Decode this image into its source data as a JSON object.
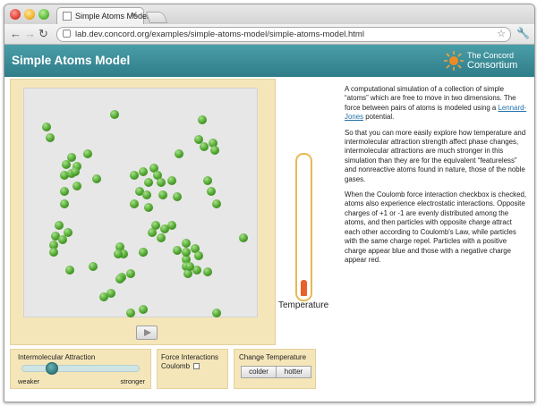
{
  "browser": {
    "tab_title": "Simple Atoms Model",
    "url": "lab.dev.concord.org/examples/simple-atoms-model/simple-atoms-model.html"
  },
  "header": {
    "title": "Simple Atoms Model",
    "logo_line1": "The Concord",
    "logo_line2": "Consortium"
  },
  "sim": {
    "atom_count": 74,
    "temperature_label": "Temperature",
    "temperature_fraction": 0.12,
    "play_icon": "play-icon"
  },
  "description": {
    "p1_before": "A computational simulation of a collection of simple “atoms” which are free to move in two dimensions. The force between pairs of atoms is modeled using a ",
    "p1_link": "Lennard-Jones",
    "p1_after": " potential.",
    "p2": "So that you can more easily explore how temperature and intermolecular attraction strength affect phase changes, intermolecular attractions are much stronger in this simulation than they are for the equivalent “featureless” and nonreactive atoms found in nature, those of the noble gases.",
    "p3": "When the Coulomb force interaction checkbox is checked, atoms also experience electrostatic interactions. Opposite charges of +1 or -1 are evenly distributed among the atoms, and then particles with opposite charge attract each other according to Coulomb's Law, while particles with the same charge repel. Particles with a positive charge appear blue and those with a negative charge appear red."
  },
  "controls": {
    "attraction": {
      "title": "Intermolecular Attraction",
      "min_label": "weaker",
      "max_label": "stronger",
      "value_fraction": 0.25
    },
    "force": {
      "title": "Force Interactions",
      "coulomb_label": "Coulomb",
      "coulomb_checked": false
    },
    "temperature": {
      "title": "Change Temperature",
      "colder_label": "colder",
      "hotter_label": "hotter"
    }
  },
  "colors": {
    "header": "#3a8d98",
    "panel": "#f5e6b9",
    "atom": "#4ea52e",
    "thermo_fill": "#e8602c",
    "thermo_border": "#e6b954"
  }
}
